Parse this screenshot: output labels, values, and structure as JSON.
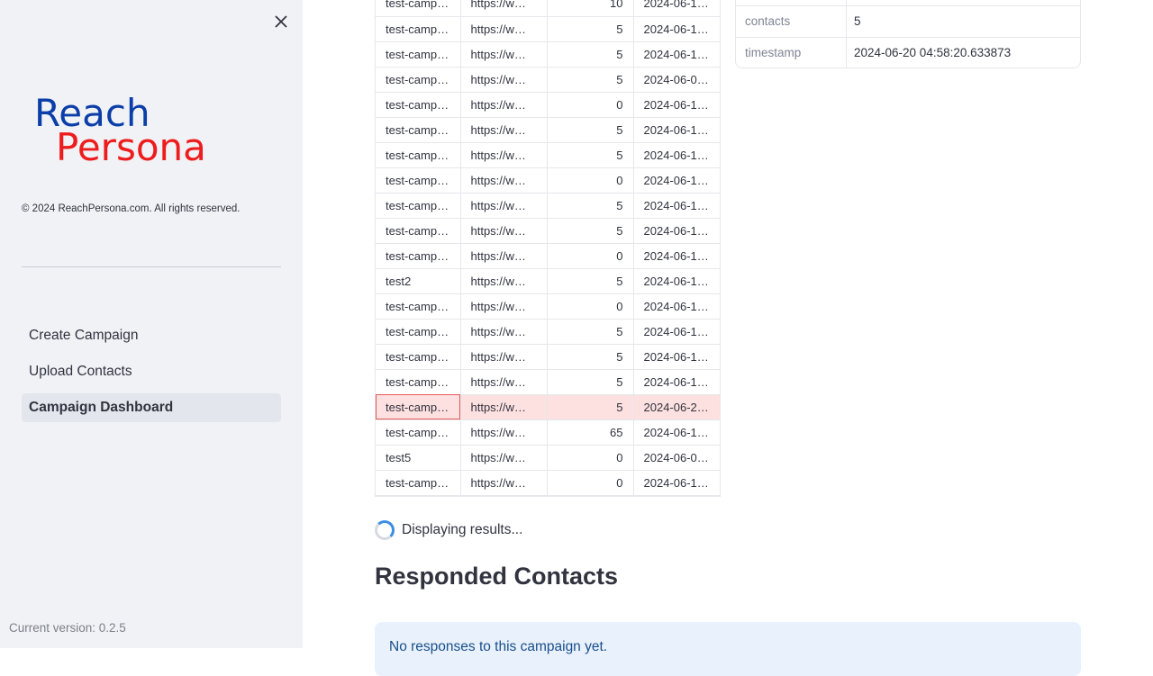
{
  "sidebar": {
    "close_icon": "close-icon",
    "logo": {
      "line1": "Reach",
      "line2": "Persona",
      "color1": "#0b3ea8",
      "color2": "#ee1c1c"
    },
    "copyright": "© 2024 ReachPersona.com. All rights reserved.",
    "nav": [
      {
        "label": "Create Campaign"
      },
      {
        "label": "Upload Contacts"
      },
      {
        "label": "Campaign Dashboard"
      }
    ],
    "version": "Current version: 0.2.5"
  },
  "campaigns": {
    "rows": [
      [
        "test-camp…",
        "https://w…",
        "10",
        "2024-06-1…"
      ],
      [
        "test-camp…",
        "https://w…",
        "5",
        "2024-06-1…"
      ],
      [
        "test-camp…",
        "https://w…",
        "5",
        "2024-06-1…"
      ],
      [
        "test-camp…",
        "https://w…",
        "5",
        "2024-06-0…"
      ],
      [
        "test-camp…",
        "https://w…",
        "0",
        "2024-06-1…"
      ],
      [
        "test-camp…",
        "https://w…",
        "5",
        "2024-06-1…"
      ],
      [
        "test-camp…",
        "https://w…",
        "5",
        "2024-06-1…"
      ],
      [
        "test-camp…",
        "https://w…",
        "0",
        "2024-06-1…"
      ],
      [
        "test-camp…",
        "https://w…",
        "5",
        "2024-06-1…"
      ],
      [
        "test-camp…",
        "https://w…",
        "5",
        "2024-06-1…"
      ],
      [
        "test-camp…",
        "https://w…",
        "0",
        "2024-06-1…"
      ],
      [
        "test2",
        "https://w…",
        "5",
        "2024-06-1…"
      ],
      [
        "test-camp…",
        "https://w…",
        "0",
        "2024-06-1…"
      ],
      [
        "test-camp…",
        "https://w…",
        "5",
        "2024-06-1…"
      ],
      [
        "test-camp…",
        "https://w…",
        "5",
        "2024-06-1…"
      ],
      [
        "test-camp…",
        "https://w…",
        "5",
        "2024-06-1…"
      ],
      [
        "test-camp…",
        "https://w…",
        "5",
        "2024-06-2…"
      ],
      [
        "test-camp…",
        "https://w…",
        "65",
        "2024-06-1…"
      ],
      [
        "test5",
        "https://w…",
        "0",
        "2024-06-0…"
      ],
      [
        "test-camp…",
        "https://w…",
        "0",
        "2024-06-1…"
      ]
    ],
    "selected_index": 16
  },
  "details": [
    {
      "key": "",
      "value": ""
    },
    {
      "key": "contacts",
      "value": "5"
    },
    {
      "key": "timestamp",
      "value": "2024-06-20 04:58:20.633873"
    }
  ],
  "status_text": "Displaying results...",
  "heading": "Responded Contacts",
  "info_text": "No responses to this campaign yet."
}
